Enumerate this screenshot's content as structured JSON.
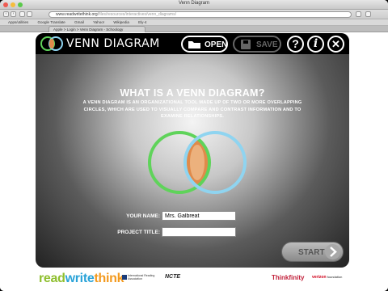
{
  "browser": {
    "window_title": "Venn Diagram",
    "url_host": "www.readwritethink.org",
    "url_rest": "/files/resources/interactives/venn_diagrams/",
    "bookmarks": [
      "Apps/utilities",
      "Google Translate",
      "Gmail",
      "Yahoo!",
      "Wikipedia",
      "Ely-4"
    ],
    "tab_title": "Apple > Login > Venn Diagram - Schoology",
    "nav_back": "‹",
    "nav_forward": "›"
  },
  "app": {
    "title": "VENN DIAGRAM",
    "open_label": "OPEN",
    "save_label": "SAVE",
    "help_label": "?",
    "info_label": "i",
    "close_label": "✕",
    "heading": "WHAT IS A VENN DIAGRAM?",
    "description": "A VENN DIAGRAM IS AN ORGANIZATIONAL TOOL MADE UP OF TWO OR MORE OVERLAPPING CIRCLES, WHICH ARE USED TO VISUALLY COMPARE AND CONTRAST INFORMATION AND TO EXAMINE RELATIONSHIPS.",
    "your_name_label": "YOUR NAME:",
    "your_name_value": "Mrs. Galbreat",
    "project_title_label": "PROJECT TITLE:",
    "project_title_value": "",
    "start_label": "START",
    "colors": {
      "left_circle": "#5fd35a",
      "right_circle": "#8fd4f0",
      "overlap": "#e08a4a"
    }
  },
  "footer": {
    "rwt_read": "read",
    "rwt_write": "write",
    "rwt_think": "think",
    "ira": "International Reading Association",
    "ncte": "NCTE",
    "thinkfinity": "Thinkfinity",
    "verizon_v": "verizon",
    "verizon_rest": "foundation"
  }
}
